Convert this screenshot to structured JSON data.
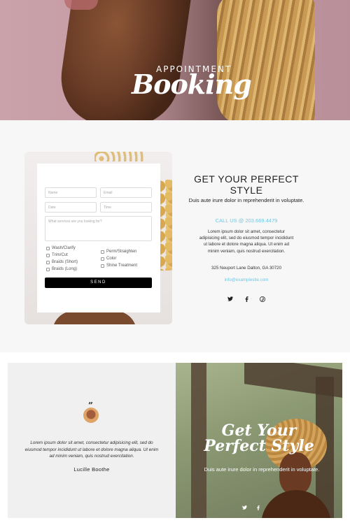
{
  "hero": {
    "label_small": "APPOINTMENT",
    "label_big": "Booking"
  },
  "form": {
    "name_placeholder": "Name",
    "email_placeholder": "Email",
    "date_placeholder": "Date",
    "time_placeholder": "Time",
    "services_placeholder": "What services are you looking for?",
    "services_left": [
      "Wash/Clarify",
      "Trim/Cut",
      "Braids (Short)",
      "Braids (Long)"
    ],
    "services_right": [
      "Perm/Straighten",
      "Color",
      "Shine Treatment"
    ],
    "send_label": "SEND"
  },
  "info": {
    "heading": "GET YOUR PERFECT STYLE",
    "lead": "Duis aute irure dolor in reprehenderit in voluptate.",
    "call": "CALL US @ 203.669.4479",
    "body": "Lorem ipsum dolor sit amet, consectetur adipisicing elit, sed do eiusmod tempor incididunt ut labore et dolore magna aliqua. Ut enim ad minim veniam, quis nostrud exercitation.",
    "address": "325 Neuport Lane Dalton, GA 30720",
    "email": "info@examplesite.com",
    "social": {
      "twitter": "twitter-icon",
      "facebook": "facebook-icon",
      "pinterest": "pinterest-icon"
    }
  },
  "testimonial": {
    "quote_mark": "”",
    "text": "Lorem ipsum dolor sit amet, consectetur adipisicing elit, sed do eiusmod tempor incididunt ut labore et dolore magna aliqua. Ut enim ad minim veniam, quis nostrud exercitation.",
    "name": "Lucille Boothe"
  },
  "promo": {
    "title_line1": "Get Your",
    "title_line2": "Perfect Style",
    "text": "Duis aute irure dolor in reprehenderit in voluptate."
  },
  "colors": {
    "accent": "#6ec8e6",
    "button": "#000000"
  }
}
